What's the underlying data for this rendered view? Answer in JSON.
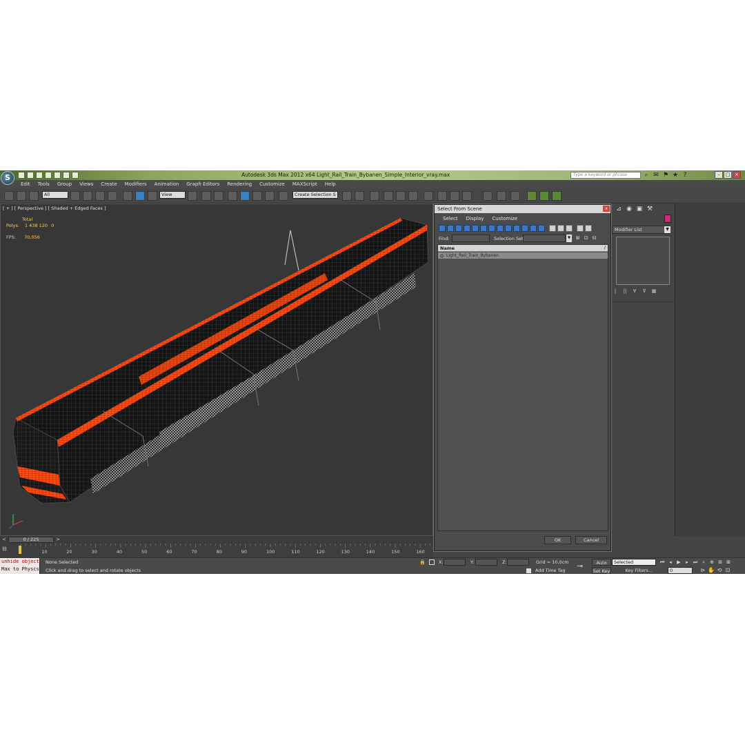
{
  "window": {
    "title": "Autodesk 3ds Max 2012 x64     Light_Rail_Train_Bybanen_Simple_Interior_vray.max",
    "search_placeholder": "Type a keyword or phrase"
  },
  "menu": [
    "Edit",
    "Tools",
    "Group",
    "Views",
    "Create",
    "Modifiers",
    "Animation",
    "Graph Editors",
    "Rendering",
    "Customize",
    "MAXScript",
    "Help"
  ],
  "toolbar": {
    "filter_dropdown": "All",
    "coord_dropdown": "View",
    "selection_set_dropdown": "Create Selection S",
    "snap_label": "3"
  },
  "viewport": {
    "label": "[ + ] [ Perspective ] [ Shaded + Edged Faces ]",
    "stats_total_label": "Total",
    "polys_label": "Polys:",
    "polys_value": "1 438 120",
    "polys_sel": "0",
    "fps_label": "FPS:",
    "fps_value": "70,056",
    "accent_color": "#ff4a10"
  },
  "timeline": {
    "frame_display": "0 / 225",
    "prev_icon": "left-arrow",
    "next_icon": "right-arrow",
    "ruler_ticks": [
      "10",
      "20",
      "30",
      "40",
      "50",
      "60",
      "70",
      "80",
      "90",
      "100",
      "110",
      "120",
      "130",
      "140",
      "150",
      "160"
    ]
  },
  "status": {
    "script_line1": "unhide object",
    "script_line2": "Max to Physcs",
    "selection": "None Selected",
    "prompt": "Click and drag to select and rotate objects",
    "x_label": "X:",
    "y_label": "Y:",
    "z_label": "Z:",
    "grid": "Grid = 10,0cm",
    "add_time_tag": "Add Time Tag",
    "auto_key": "Auto Key",
    "set_key": "Set Key",
    "selected_dropdown": "Selected",
    "key_filters": "Key Filters...",
    "frame_value": "0"
  },
  "command_panel": {
    "modifier_list": "Modifier List",
    "swatch_color": "#cc2a7a"
  },
  "dialog": {
    "title": "Select From Scene",
    "close": "x",
    "menu": [
      "Select",
      "Display",
      "Customize"
    ],
    "find_label": "Find:",
    "selection_set_label": "Selection Set:",
    "column_name": "Name",
    "column_sort": "/",
    "rows": [
      {
        "name": "Light_Rail_Train_Bybanen",
        "icon": "object-icon"
      }
    ],
    "ok": "OK",
    "cancel": "Cancel"
  }
}
